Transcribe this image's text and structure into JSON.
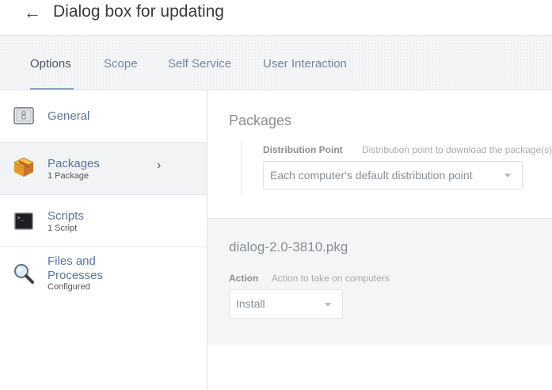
{
  "header": {
    "back_icon": "arrow-left-icon",
    "title": "Dialog box for updating"
  },
  "tabs": [
    {
      "label": "Options",
      "active": true
    },
    {
      "label": "Scope"
    },
    {
      "label": "Self Service"
    },
    {
      "label": "User Interaction"
    }
  ],
  "sidebar": {
    "items": [
      {
        "label": "General",
        "sub": "",
        "icon": "general-switch-icon"
      },
      {
        "label": "Packages",
        "sub": "1 Package",
        "icon": "package-box-icon",
        "active": true
      },
      {
        "label": "Scripts",
        "sub": "1 Script",
        "icon": "terminal-icon"
      },
      {
        "label": "Files and\nProcesses",
        "label_line1": "Files and",
        "label_line2": "Processes",
        "sub": "Configured",
        "icon": "magnifier-icon"
      }
    ]
  },
  "packages_section": {
    "title": "Packages",
    "distribution_point": {
      "label": "Distribution Point",
      "description": "Distribution point to download the package(s) from",
      "value": "Each computer's default distribution point"
    }
  },
  "package_item": {
    "filename": "dialog-2.0-3810.pkg",
    "action": {
      "label": "Action",
      "description": "Action to take on computers",
      "value": "Install"
    }
  },
  "colors": {
    "link": "#5a7598",
    "muted": "#8a8f95",
    "accent_underline": "#8aa3c2"
  }
}
